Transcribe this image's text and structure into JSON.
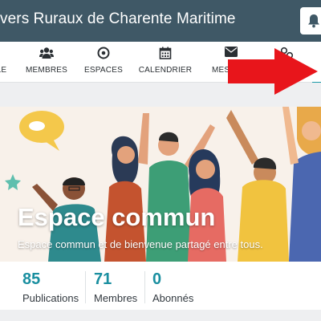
{
  "header": {
    "title": "vers Ruraux de Charente Maritime",
    "bell_icon": "bell-icon"
  },
  "nav": {
    "items": [
      {
        "label": "LE",
        "icon": "home-icon"
      },
      {
        "label": "MEMBRES",
        "icon": "users-icon"
      },
      {
        "label": "ESPACES",
        "icon": "target-icon"
      },
      {
        "label": "CALENDRIER",
        "icon": "calendar-icon"
      },
      {
        "label": "MESS",
        "icon": "envelope-icon"
      },
      {
        "label": "",
        "icon": "links-icon"
      }
    ]
  },
  "banner": {
    "title": "Espace commun",
    "subtitle": "Espace commun et de bienvenue partagé entre tous."
  },
  "stats": [
    {
      "value": "85",
      "label": "Publications"
    },
    {
      "value": "71",
      "label": "Membres"
    },
    {
      "value": "0",
      "label": "Abonnés"
    }
  ],
  "colors": {
    "topbar": "#3f5866",
    "accent": "#1a8fa0",
    "arrow": "#e8151b"
  }
}
